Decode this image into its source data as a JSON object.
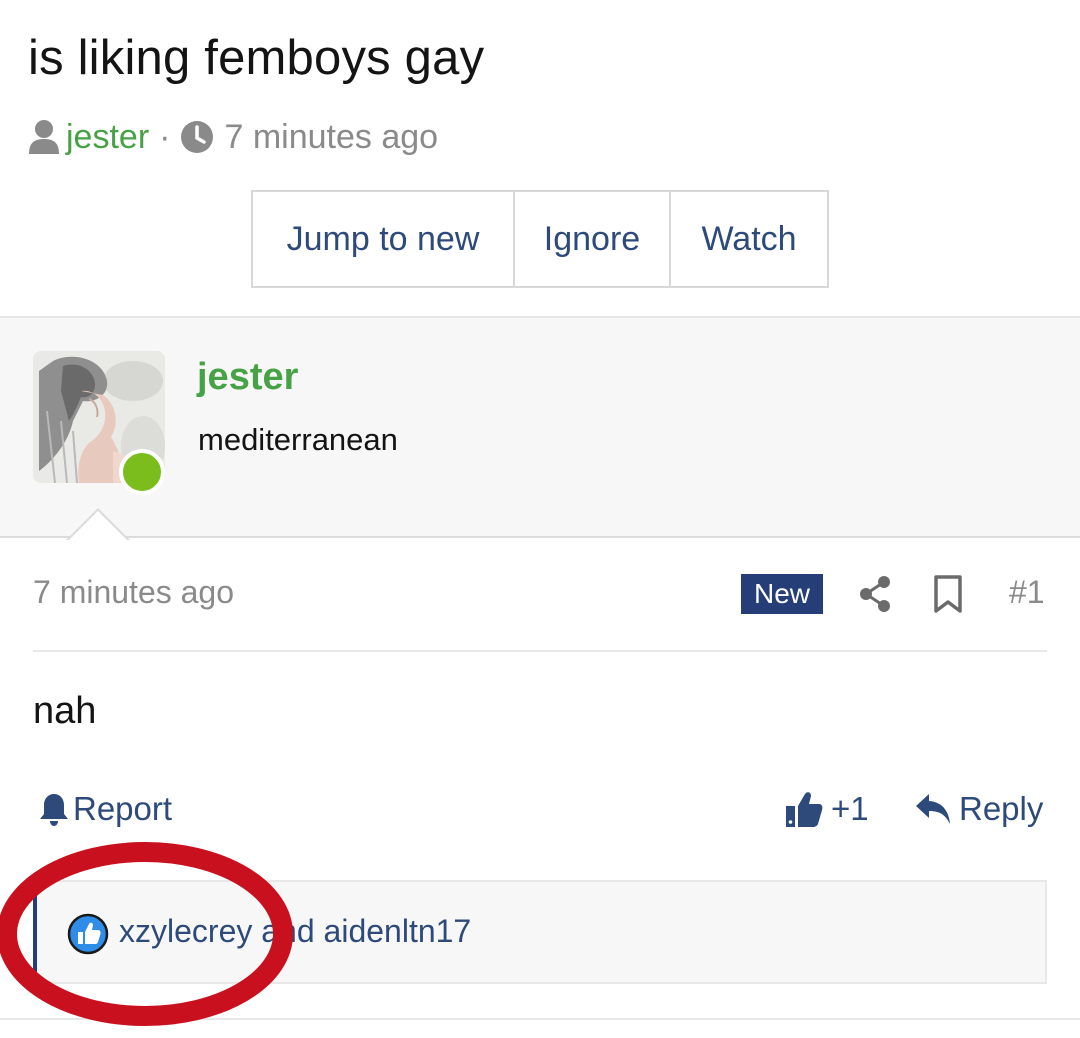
{
  "thread": {
    "title": "is liking femboys gay",
    "author": "jester",
    "separator": "·",
    "time": "7 minutes ago"
  },
  "buttons": {
    "jump": "Jump to new",
    "ignore": "Ignore",
    "watch": "Watch"
  },
  "author_panel": {
    "name": "jester",
    "user_title": "mediterranean",
    "online": true
  },
  "post": {
    "date": "7 minutes ago",
    "badge": "New",
    "number": "#1",
    "body": "nah",
    "report_label": "Report",
    "like_count": "+1",
    "reply_label": "Reply"
  },
  "reactions": {
    "text": "xzylecrey and aidenltn17"
  },
  "colors": {
    "author_green": "#47a247",
    "link_blue": "#2d4a7a",
    "badge_navy": "#253e78",
    "online_green": "#7cbd1e",
    "annotation_red": "#c8101e"
  },
  "icons": [
    "user-icon",
    "clock-icon",
    "share-icon",
    "bookmark-icon",
    "bell-icon",
    "thumbs-up-icon",
    "reply-icon",
    "like-reaction-icon"
  ]
}
